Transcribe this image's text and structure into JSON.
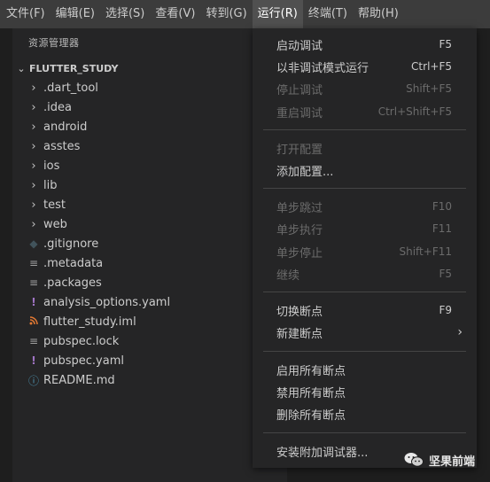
{
  "menubar": {
    "items": [
      {
        "label": "文件(F)"
      },
      {
        "label": "编辑(E)"
      },
      {
        "label": "选择(S)"
      },
      {
        "label": "查看(V)"
      },
      {
        "label": "转到(G)"
      },
      {
        "label": "运行(R)",
        "active": true
      },
      {
        "label": "终端(T)"
      },
      {
        "label": "帮助(H)"
      }
    ]
  },
  "explorer": {
    "title": "资源管理器",
    "section": "FLUTTER_STUDY",
    "items": [
      {
        "label": ".dart_tool",
        "icon": "chevron-right-icon"
      },
      {
        "label": ".idea",
        "icon": "chevron-right-icon"
      },
      {
        "label": "android",
        "icon": "chevron-right-icon"
      },
      {
        "label": "asstes",
        "icon": "chevron-right-icon"
      },
      {
        "label": "ios",
        "icon": "chevron-right-icon"
      },
      {
        "label": "lib",
        "icon": "chevron-right-icon"
      },
      {
        "label": "test",
        "icon": "chevron-right-icon"
      },
      {
        "label": "web",
        "icon": "chevron-right-icon"
      },
      {
        "label": ".gitignore",
        "icon": "git-icon"
      },
      {
        "label": ".metadata",
        "icon": "lines-icon"
      },
      {
        "label": ".packages",
        "icon": "lines-icon"
      },
      {
        "label": "analysis_options.yaml",
        "icon": "exclamation-icon"
      },
      {
        "label": "flutter_study.iml",
        "icon": "rss-icon"
      },
      {
        "label": "pubspec.lock",
        "icon": "lines-icon"
      },
      {
        "label": "pubspec.yaml",
        "icon": "exclamation-icon"
      },
      {
        "label": "README.md",
        "icon": "info-icon"
      }
    ]
  },
  "run_menu": {
    "items": [
      {
        "label": "启动调试",
        "shortcut": "F5",
        "enabled": true
      },
      {
        "label": "以非调试模式运行",
        "shortcut": "Ctrl+F5",
        "enabled": true
      },
      {
        "label": "停止调试",
        "shortcut": "Shift+F5",
        "enabled": false
      },
      {
        "label": "重启调试",
        "shortcut": "Ctrl+Shift+F5",
        "enabled": false
      },
      {
        "label": "打开配置",
        "shortcut": "",
        "enabled": false
      },
      {
        "label": "添加配置...",
        "shortcut": "",
        "enabled": true
      },
      {
        "label": "单步跳过",
        "shortcut": "F10",
        "enabled": false
      },
      {
        "label": "单步执行",
        "shortcut": "F11",
        "enabled": false
      },
      {
        "label": "单步停止",
        "shortcut": "Shift+F11",
        "enabled": false
      },
      {
        "label": "继续",
        "shortcut": "F5",
        "enabled": false
      },
      {
        "label": "切换断点",
        "shortcut": "F9",
        "enabled": true
      },
      {
        "label": "新建断点",
        "shortcut": "",
        "enabled": true,
        "submenu": true
      },
      {
        "label": "启用所有断点",
        "shortcut": "",
        "enabled": true
      },
      {
        "label": "禁用所有断点",
        "shortcut": "",
        "enabled": true
      },
      {
        "label": "删除所有断点",
        "shortcut": "",
        "enabled": true
      },
      {
        "label": "安装附加调试器...",
        "shortcut": "",
        "enabled": true
      }
    ]
  },
  "watermark": {
    "text": "坚果前端"
  },
  "colors": {
    "menubar": "#3c3c3c",
    "menu_bg": "#252526",
    "disabled": "#6b6b6b",
    "accent_rss": "#e37933",
    "accent_yaml": "#a074c4",
    "accent_info": "#519aba"
  }
}
